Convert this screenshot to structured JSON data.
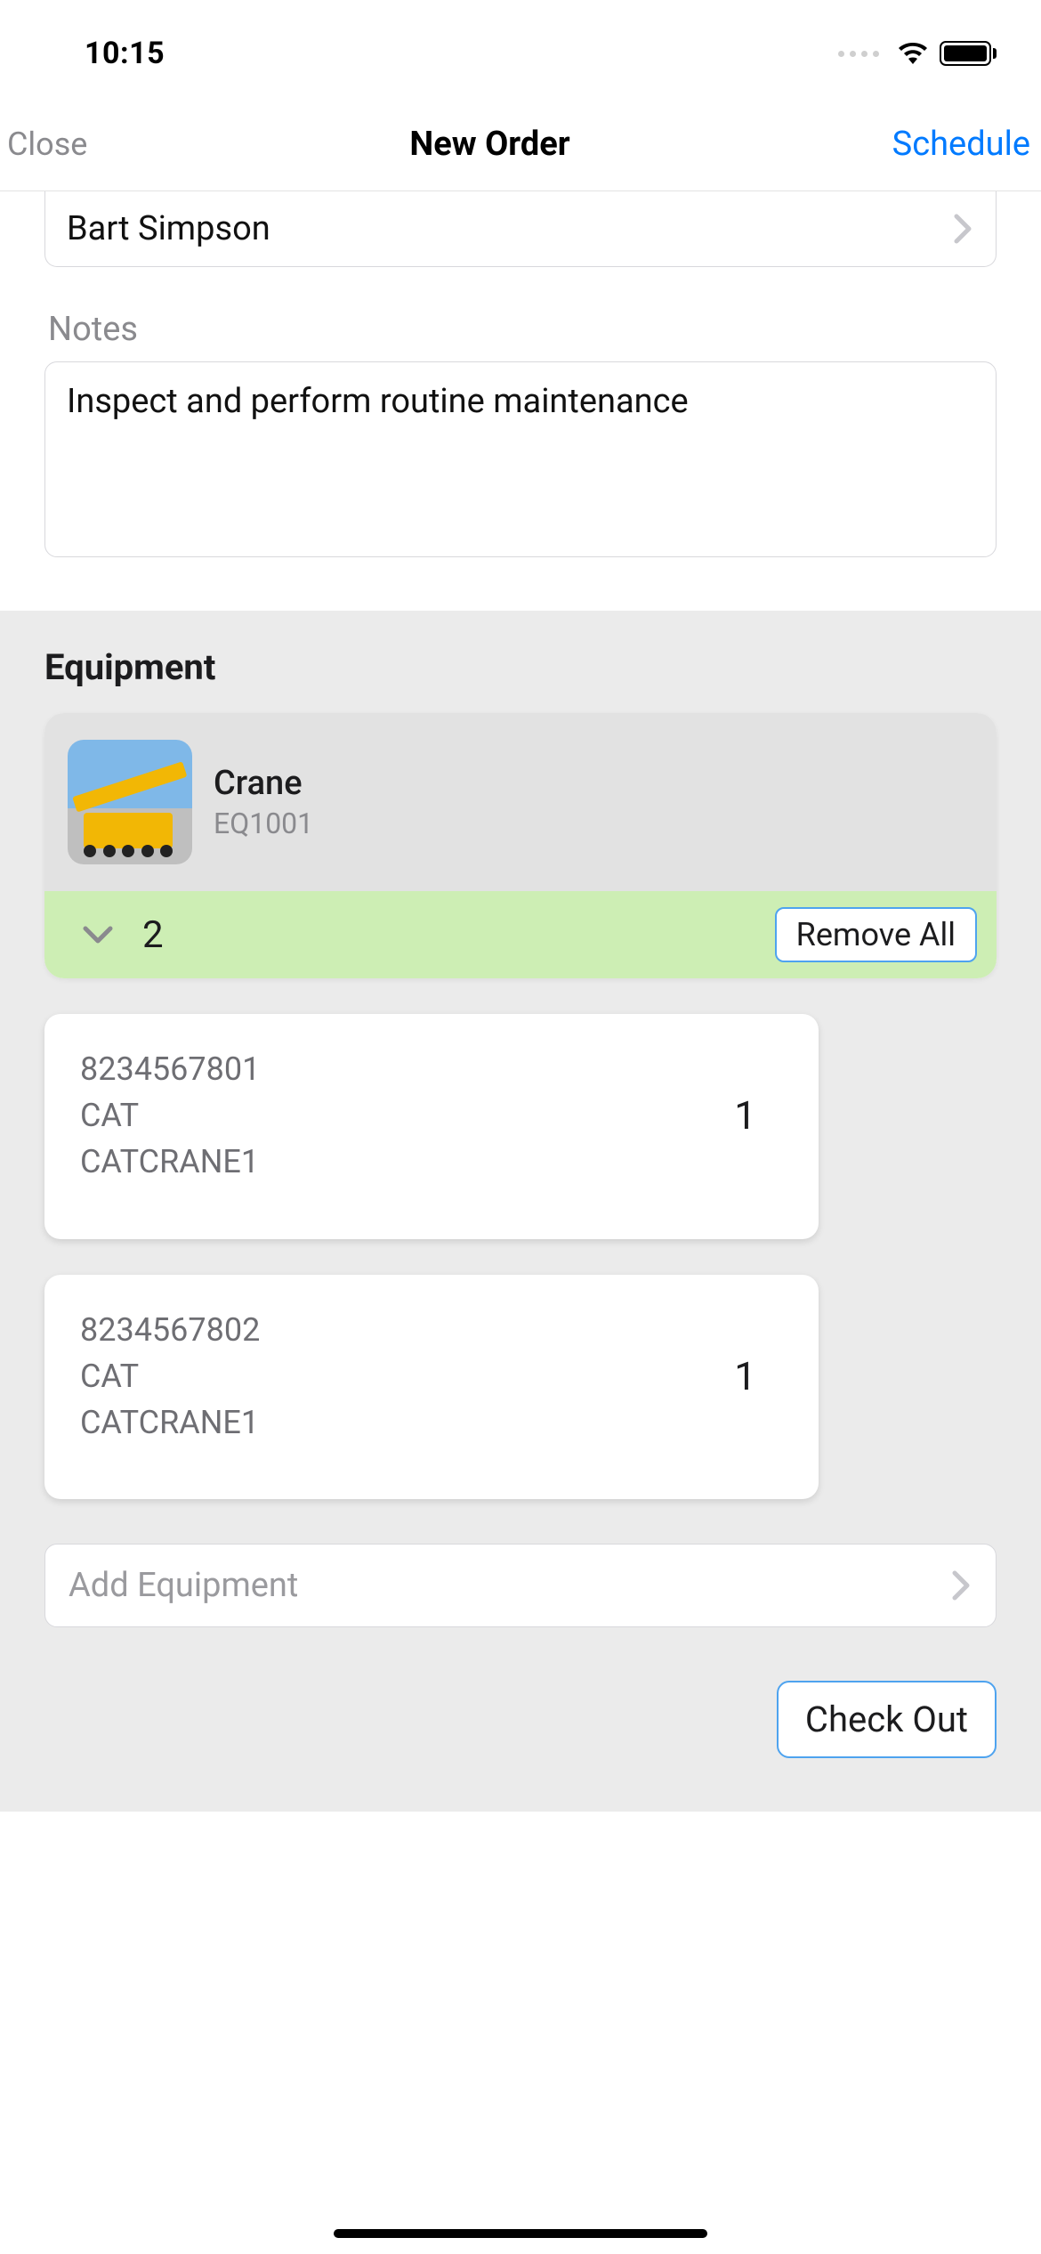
{
  "status": {
    "time": "10:15"
  },
  "nav": {
    "close": "Close",
    "title": "New Order",
    "schedule": "Schedule"
  },
  "form": {
    "person": "Bart Simpson",
    "notes_label": "Notes",
    "notes_value": "Inspect and perform routine maintenance"
  },
  "equipment": {
    "section_title": "Equipment",
    "group": {
      "name": "Crane",
      "code": "EQ1001",
      "count": "2",
      "remove_all": "Remove All"
    },
    "items": [
      {
        "serial": "8234567801",
        "make": "CAT",
        "model": "CATCRANE1",
        "qty": "1"
      },
      {
        "serial": "8234567802",
        "make": "CAT",
        "model": "CATCRANE1",
        "qty": "1"
      }
    ],
    "add_label": "Add Equipment"
  },
  "footer": {
    "checkout": "Check Out"
  }
}
